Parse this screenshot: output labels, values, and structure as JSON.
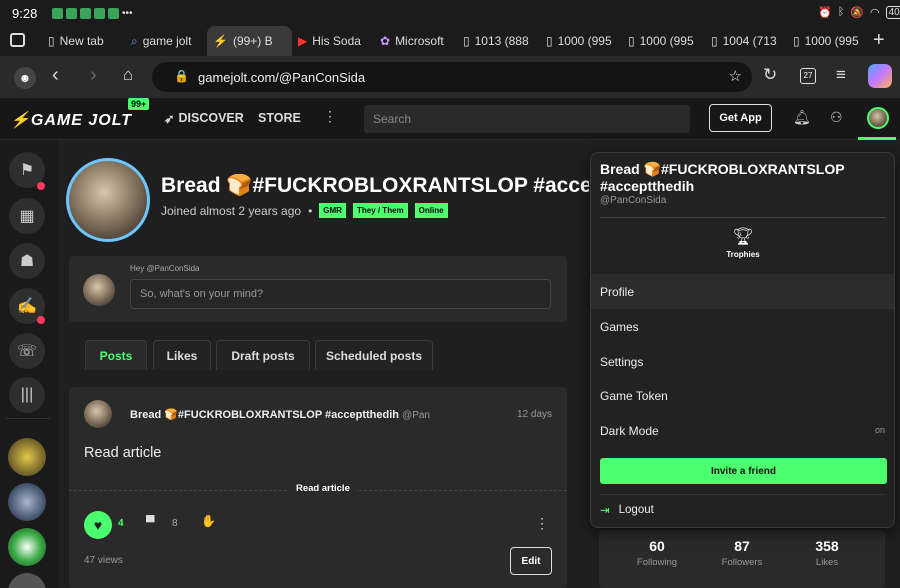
{
  "status": {
    "time": "9:28",
    "battery": "40"
  },
  "browser": {
    "tabs": [
      {
        "label": "New tab"
      },
      {
        "label": "game jolt"
      },
      {
        "label": "(99+) B"
      },
      {
        "label": "His Soda"
      },
      {
        "label": "Microsoft"
      },
      {
        "label": "1013 (888"
      },
      {
        "label": "1000 (995"
      },
      {
        "label": "1000 (995"
      },
      {
        "label": "1004 (713"
      },
      {
        "label": "1000 (995"
      }
    ],
    "url": "gamejolt.com/@PanConSida",
    "tab_count": "27"
  },
  "gj": {
    "logo": "GAME JOLT",
    "badge": "99+",
    "discover": "DISCOVER",
    "store": "STORE",
    "search_placeholder": "Search",
    "get_app": "Get App"
  },
  "profile": {
    "name": "Bread 🍞#FUCKROBLOXRANTSLOP #accep",
    "joined": "Joined almost 2 years ago",
    "sep": "•",
    "tags": [
      "GMR",
      "They / Them",
      "Online"
    ]
  },
  "composer": {
    "hey": "Hey @PanConSida",
    "placeholder": "So, what's on your mind?"
  },
  "post_tabs": [
    "Posts",
    "Likes",
    "Draft posts",
    "Scheduled posts"
  ],
  "post": {
    "author": "Bread 🍞#FUCKROBLOXRANTSLOP #acceptthedih",
    "handle": "@PanConSida",
    "age": "12 days",
    "body": "Read article",
    "read_article": "Read article",
    "likes": "4",
    "comments": "8",
    "views": "47 views",
    "edit": "Edit"
  },
  "menu": {
    "name": "Bread 🍞#FUCKROBLOXRANTSLOP #acceptthedih",
    "handle": "@PanConSida",
    "trophies": "Trophies",
    "items": [
      "Profile",
      "Games",
      "Settings",
      "Game Token",
      "Dark Mode"
    ],
    "dark_mode_state": "on",
    "invite": "Invite a friend",
    "logout": "Logout"
  },
  "stats": [
    {
      "value": "60",
      "label": "Following"
    },
    {
      "value": "87",
      "label": "Followers"
    },
    {
      "value": "358",
      "label": "Likes"
    }
  ],
  "colors": {
    "accent": "#4bff6e",
    "notify": "#ff3b5c"
  }
}
